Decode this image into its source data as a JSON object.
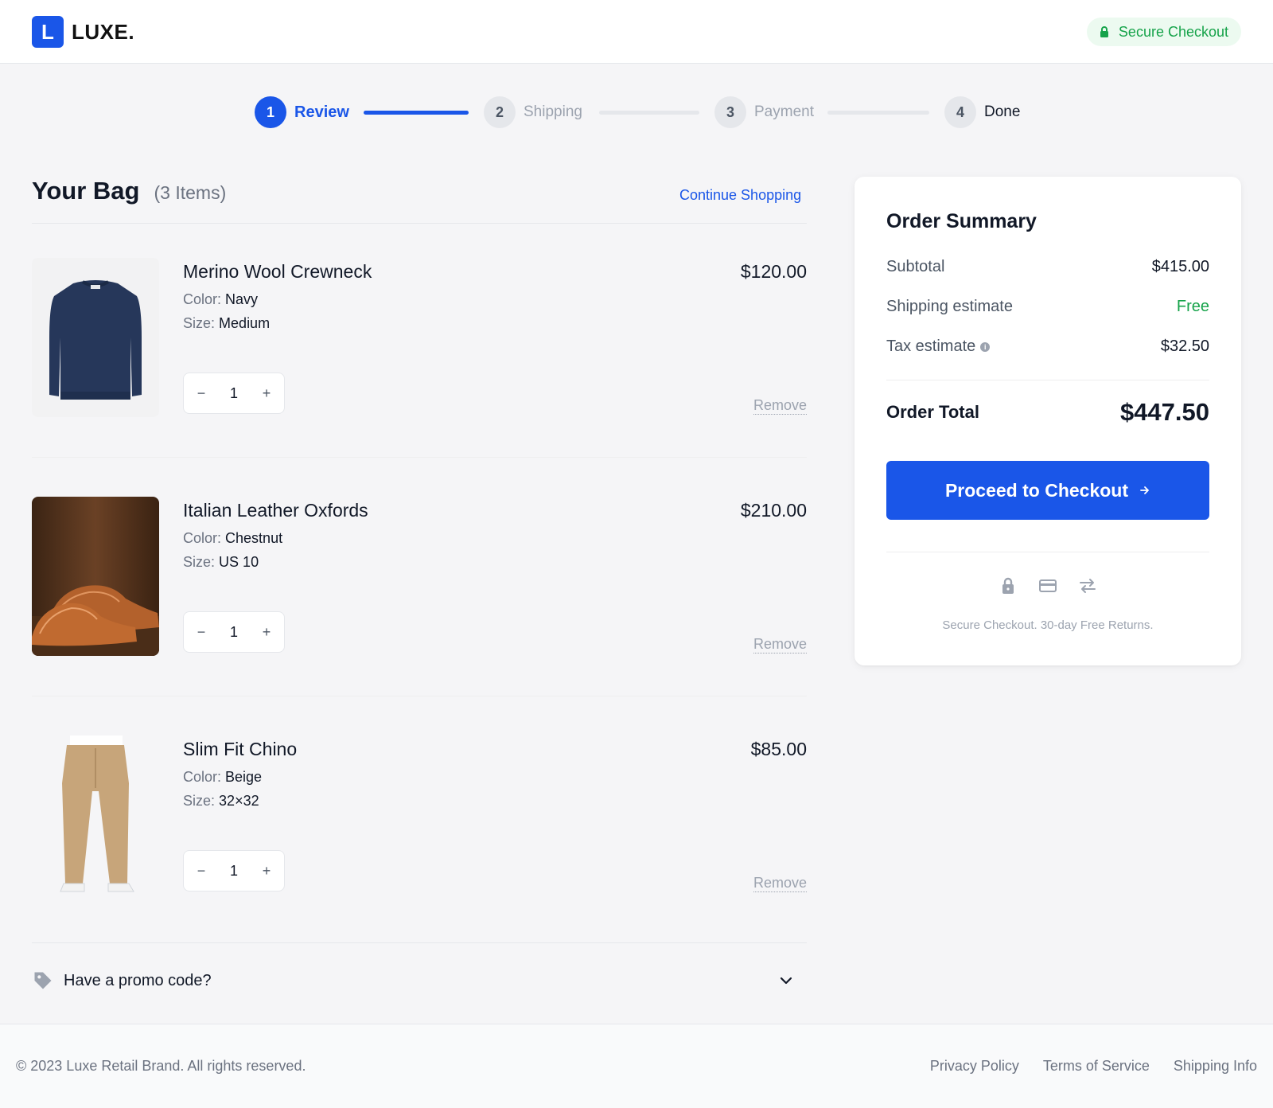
{
  "header": {
    "logo_letter": "L",
    "brand": "LUXE.",
    "secure_label": "Secure Checkout",
    "accent_color": "#1a56e8",
    "secure_color": "#16a34a"
  },
  "stepper": {
    "steps": [
      {
        "number": "1",
        "label": "Review",
        "state": "active"
      },
      {
        "number": "2",
        "label": "Shipping",
        "state": "pending"
      },
      {
        "number": "3",
        "label": "Payment",
        "state": "pending"
      },
      {
        "number": "4",
        "label": "Done",
        "state": "pending"
      }
    ]
  },
  "bag": {
    "title": "Your Bag",
    "count": "(3 Items)",
    "continue_label": "Continue Shopping",
    "color_label": "Color:",
    "size_label": "Size:",
    "remove_label": "Remove",
    "items": [
      {
        "name": "Merino Wool Crewneck",
        "color": "Navy",
        "size": "Medium",
        "price": "$120.00",
        "qty": "1",
        "image": "navy-sweater"
      },
      {
        "name": "Italian Leather Oxfords",
        "color": "Chestnut",
        "size": "US 10",
        "price": "$210.00",
        "qty": "1",
        "image": "brown-oxford-shoes"
      },
      {
        "name": "Slim Fit Chino",
        "color": "Beige",
        "size": "32×32",
        "price": "$85.00",
        "qty": "1",
        "image": "beige-chino-pants"
      }
    ],
    "promo_label": "Have a promo code?"
  },
  "summary": {
    "title": "Order Summary",
    "subtotal_label": "Subtotal",
    "subtotal": "$415.00",
    "shipping_label": "Shipping estimate",
    "shipping": "Free",
    "tax_label": "Tax estimate",
    "tax_info": "i",
    "tax": "$32.50",
    "total_label": "Order Total",
    "total": "$447.50",
    "checkout_label": "Proceed to Checkout",
    "trust_text": "Secure Checkout. 30-day Free Returns."
  },
  "footer": {
    "copyright": "© 2023 Luxe Retail Brand. All rights reserved.",
    "links": [
      "Privacy Policy",
      "Terms of Service",
      "Shipping Info"
    ]
  }
}
